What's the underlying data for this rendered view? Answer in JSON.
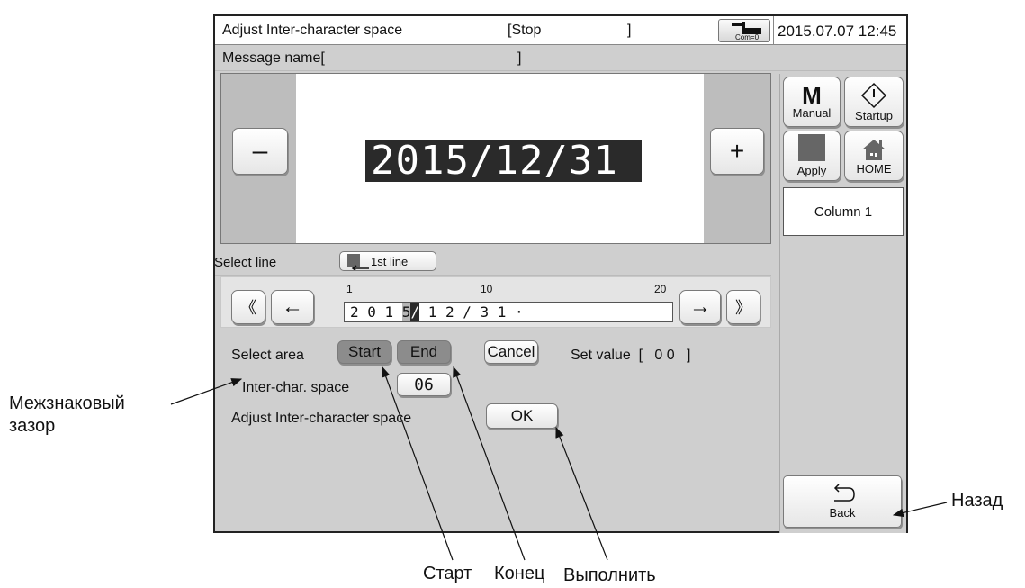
{
  "titlebar": {
    "title": "Adjust Inter-character space",
    "status_open": "[Stop",
    "status_close": "]",
    "com_label": "Com=0",
    "datetime": "2015.07.07 12:45"
  },
  "message_name": {
    "label": "Message name[",
    "close": "]"
  },
  "preview": {
    "text": "2015/12/31",
    "minus": "–",
    "plus": "+"
  },
  "select_line": {
    "label": "Select line",
    "button": "1st line"
  },
  "cursor": {
    "ruler_1": "1",
    "ruler_10": "10",
    "ruler_20": "20",
    "chars_before": "2 0 1 ",
    "char_sel1": "5",
    "char_sel2": "∕",
    "chars_after": " 1 2 ∕ 3 1 ·",
    "double_left": "《",
    "left": "←",
    "right": "→",
    "double_right": "》"
  },
  "controls": {
    "select_area_label": "Select area",
    "start": "Start",
    "end": "End",
    "cancel": "Cancel",
    "set_value": "Set value  [   0 0   ]",
    "inter_char_label": "Inter-char. space",
    "inter_char_value": "06",
    "adjust_label": "Adjust Inter-character space",
    "ok": "OK"
  },
  "side": {
    "manual": "Manual",
    "manual_letter": "M",
    "startup": "Startup",
    "apply": "Apply",
    "home": "HOME",
    "column": "Column 1",
    "back": "Back"
  },
  "annotations": {
    "gap_line1": "Межзнаковый",
    "gap_line2": "зазор",
    "back": "Назад",
    "start": "Старт",
    "end": "Конец",
    "execute": "Выполнить"
  },
  "colors": {
    "screen_bg": "#cfcfcf",
    "selected_button": "#8c8c8c",
    "preview_text_bg": "#2a2a2a"
  }
}
